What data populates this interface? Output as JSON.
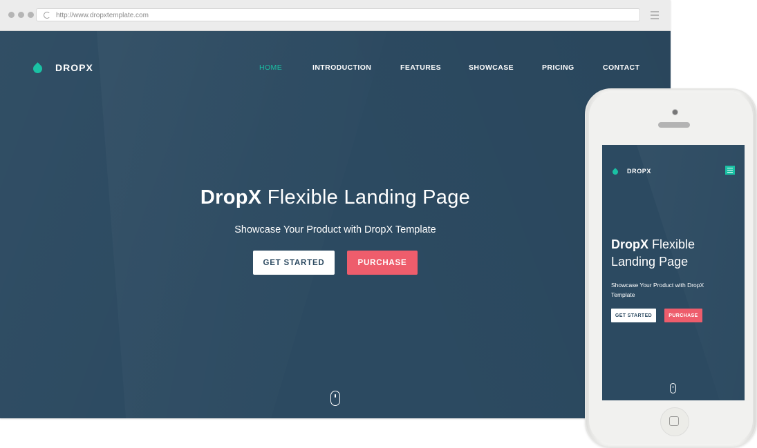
{
  "browser": {
    "url": "http://www.dropxtemplate.com"
  },
  "site": {
    "brand": "DROPX",
    "nav": [
      {
        "label": "HOME",
        "active": true
      },
      {
        "label": "INTRODUCTION",
        "active": false
      },
      {
        "label": "FEATURES",
        "active": false
      },
      {
        "label": "SHOWCASE",
        "active": false
      },
      {
        "label": "PRICING",
        "active": false
      },
      {
        "label": "CONTACT",
        "active": false
      }
    ],
    "headline_bold": "DropX",
    "headline_light": "Flexible Landing Page",
    "subheadline": "Showcase Your Product with DropX Template",
    "cta_primary": "GET STARTED",
    "cta_secondary": "PURCHASE"
  },
  "mobile": {
    "brand": "DROPX",
    "headline_bold": "DropX",
    "headline_light_line1": "Flexible",
    "headline_light_line2": "Landing Page",
    "subheadline": "Showcase Your Product with DropX Template",
    "cta_primary": "GET STARTED",
    "cta_secondary": "PURCHASE"
  },
  "colors": {
    "hero_bg": "#2c4a61",
    "accent": "#1ac1a4",
    "cta_red": "#ee5d6c"
  },
  "icons": [
    "droplet-logo-icon",
    "reload-icon",
    "browser-menu-icon",
    "scroll-mouse-icon",
    "hamburger-menu-icon",
    "phone-home-button-icon"
  ]
}
